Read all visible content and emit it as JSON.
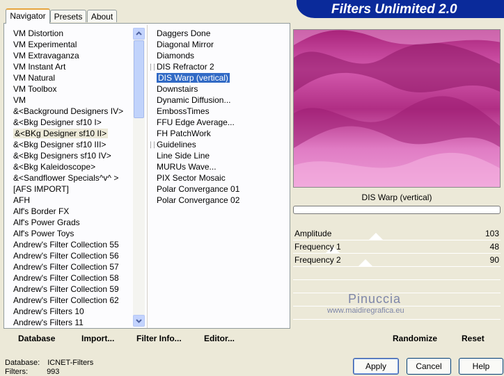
{
  "tabs": [
    "Navigator",
    "Presets",
    "About"
  ],
  "app_title": "Filters Unlimited 2.0",
  "categories": [
    "VM Distortion",
    "VM Experimental",
    "VM Extravaganza",
    "VM Instant Art",
    "VM Natural",
    "VM Toolbox",
    "VM",
    "&<Background Designers IV>",
    "&<Bkg Designer sf10 I>",
    "&<BKg Designer sf10 II>",
    "&<Bkg Designer sf10 III>",
    "&<Bkg Designers sf10 IV>",
    "&<Bkg Kaleidoscope>",
    "&<Sandflower Specials^v^ >",
    "[AFS IMPORT]",
    "AFH",
    "Alf's Border FX",
    "Alf's Power Grads",
    "Alf's Power Toys",
    "Andrew's Filter Collection 55",
    "Andrew's Filter Collection 56",
    "Andrew's Filter Collection 57",
    "Andrew's Filter Collection 58",
    "Andrew's Filter Collection 59",
    "Andrew's Filter Collection 62",
    "Andrew's Filters 10",
    "Andrew's Filters 11"
  ],
  "selected_category": "&<BKg Designer sf10 II>",
  "filters": [
    "Daggers Done",
    "Diagonal Mirror",
    "Diamonds",
    "DIS Refractor 2",
    "DIS Warp (vertical)",
    "Downstairs",
    "Dynamic Diffusion...",
    "EmbossTimes",
    "FFU Edge Average...",
    "FH PatchWork",
    "Guidelines",
    "Line Side Line",
    "MURUs Wave...",
    "PIX Sector Mosaic",
    "Polar Convergance 01",
    "Polar Convergance 02"
  ],
  "selected_filter": "DIS Warp (vertical)",
  "preview_caption": "DIS Warp (vertical)",
  "params": [
    {
      "label": "Amplitude",
      "value": "103",
      "level": 0.4
    },
    {
      "label": "Frequency 1",
      "value": "48",
      "level": 0.19
    },
    {
      "label": "Frequency 2",
      "value": "90",
      "level": 0.35
    }
  ],
  "watermark": {
    "name": "Pinuccia",
    "site": "www.maidiregrafica.eu"
  },
  "left_buttons": {
    "database": "Database",
    "import": "Import...",
    "filter_info": "Filter Info...",
    "editor": "Editor..."
  },
  "right_buttons": {
    "randomize": "Randomize",
    "reset": "Reset"
  },
  "dialog_buttons": {
    "apply": "Apply",
    "cancel": "Cancel",
    "help": "Help"
  },
  "status": {
    "database_label": "Database:",
    "database_value": "ICNET-Filters",
    "filters_label": "Filters:",
    "filters_value": "993"
  },
  "colors": {
    "banner": "#0a2a9a",
    "selection": "#316ac5",
    "preview_light": "#e07cc4",
    "preview_dark": "#9a1a70"
  }
}
